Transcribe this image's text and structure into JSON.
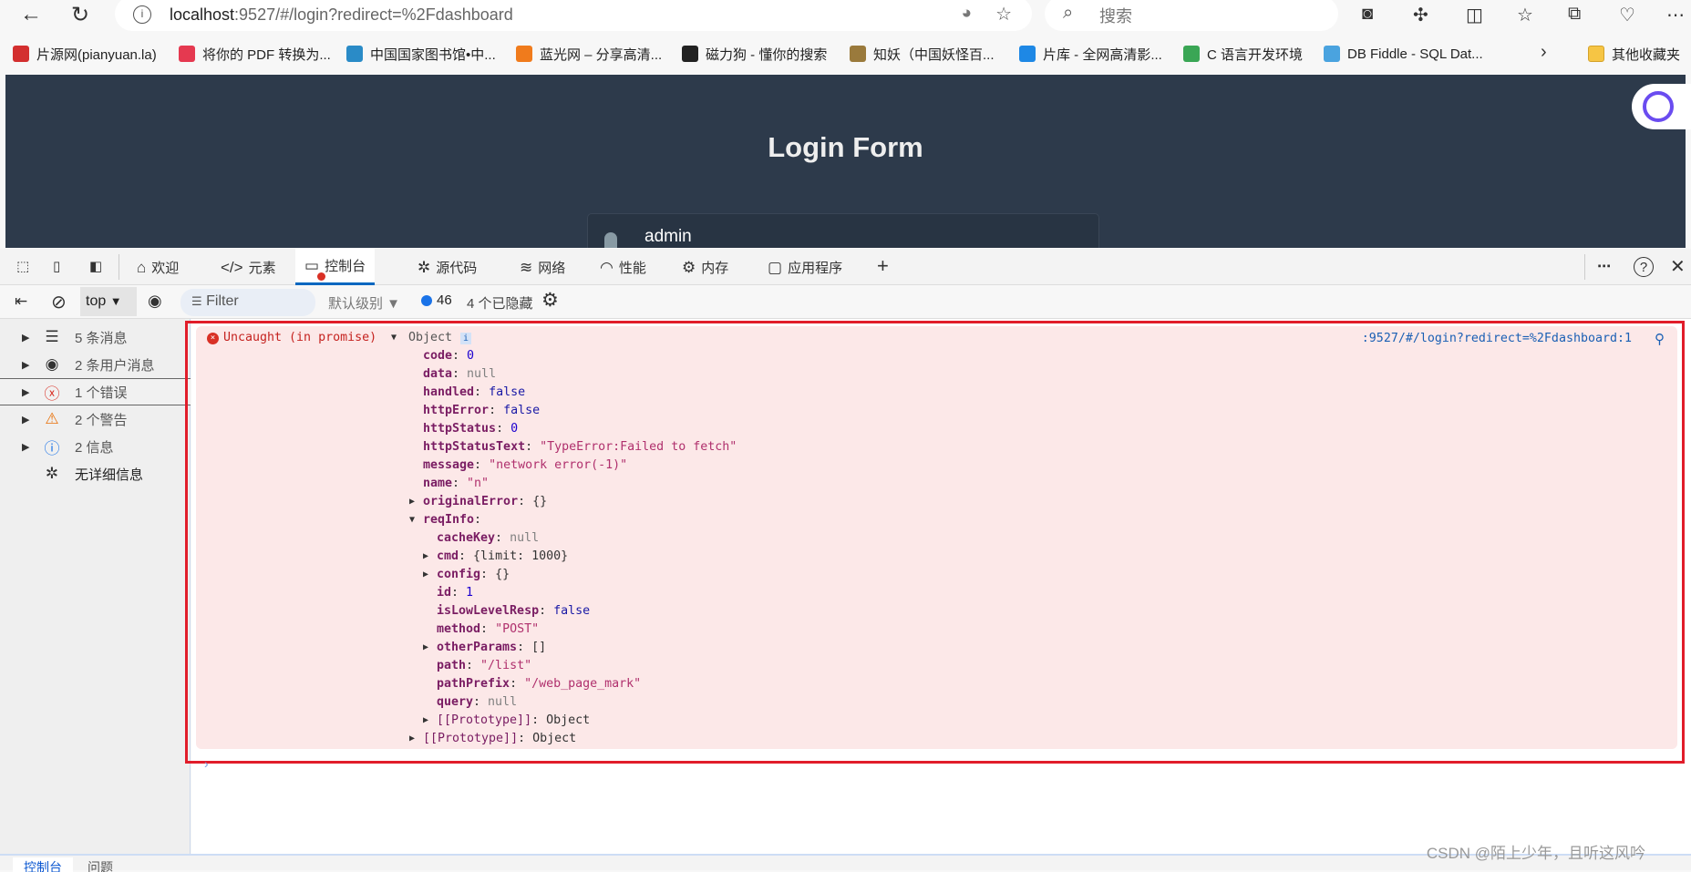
{
  "browser": {
    "url_host": "localhost",
    "url_rest": ":9527/#/login?redirect=%2Fdashboard",
    "search_placeholder": "搜索",
    "bookmarks": [
      {
        "label": "片源网(pianyuan.la)",
        "color": "#d32f2f"
      },
      {
        "label": "将你的 PDF 转换为...",
        "color": "#e53950"
      },
      {
        "label": "中国国家图书馆•中...",
        "color": "#2a8bc7"
      },
      {
        "label": "蓝光网 – 分享高清...",
        "color": "#f07b1c"
      },
      {
        "label": "磁力狗 - 懂你的搜索",
        "color": "#222222"
      },
      {
        "label": "知妖（中国妖怪百...",
        "color": "#9a7a3c"
      },
      {
        "label": "片库 - 全网高清影...",
        "color": "#1e88e5"
      },
      {
        "label": "C 语言开发环境",
        "color": "#3aa655"
      },
      {
        "label": "DB Fiddle - SQL Dat...",
        "color": "#4aa3df"
      }
    ],
    "other_bookmarks": "其他收藏夹"
  },
  "page": {
    "title": "Login Form",
    "username": "admin"
  },
  "devtools": {
    "tabs": [
      {
        "label": "欢迎",
        "icon": "home-icon"
      },
      {
        "label": "元素",
        "icon": "code-icon"
      },
      {
        "label": "控制台",
        "icon": "console-icon"
      },
      {
        "label": "源代码",
        "icon": "bug-icon"
      },
      {
        "label": "网络",
        "icon": "wifi-icon"
      },
      {
        "label": "性能",
        "icon": "gauge-icon"
      },
      {
        "label": "内存",
        "icon": "chip-icon"
      },
      {
        "label": "应用程序",
        "icon": "app-icon"
      }
    ],
    "active_tab": "控制台",
    "context": "top",
    "filter_placeholder": "Filter",
    "level": "默认级别",
    "message_count": "46",
    "hidden": "4 个已隐藏",
    "sidebar": [
      {
        "label": "5 条消息",
        "icon": "list-icon"
      },
      {
        "label": "2 条用户消息",
        "icon": "user-icon"
      },
      {
        "label": "1 个错误",
        "icon": "error-icon",
        "color": "#d93025"
      },
      {
        "label": "2 个警告",
        "icon": "warning-icon",
        "color": "#e8710a"
      },
      {
        "label": "2 信息",
        "icon": "info-icon",
        "color": "#1a73e8"
      },
      {
        "label": "无详细信息",
        "icon": "bug-icon"
      }
    ],
    "drawer_tabs": [
      "控制台",
      "问题"
    ]
  },
  "console": {
    "error_prefix": "Uncaught (in promise)",
    "object_label": "Object",
    "source": ":9527/#/login?redirect=%2Fdashboard:1",
    "props": [
      {
        "key": "code",
        "value": "0",
        "type": "num"
      },
      {
        "key": "data",
        "value": "null",
        "type": "nul"
      },
      {
        "key": "handled",
        "value": "false",
        "type": "bool"
      },
      {
        "key": "httpError",
        "value": "false",
        "type": "bool"
      },
      {
        "key": "httpStatus",
        "value": "0",
        "type": "num"
      },
      {
        "key": "httpStatusText",
        "value": "\"TypeError:Failed to fetch\"",
        "type": "str"
      },
      {
        "key": "message",
        "value": "\"network error(-1)\"",
        "type": "str"
      },
      {
        "key": "name",
        "value": "\"n\"",
        "type": "str"
      },
      {
        "key": "originalError",
        "value": "{}",
        "type": "obj",
        "expand": "collapsed"
      },
      {
        "key": "reqInfo",
        "value": "",
        "type": "obj",
        "expand": "expanded"
      }
    ],
    "reqInfo": [
      {
        "key": "cacheKey",
        "value": "null",
        "type": "nul"
      },
      {
        "key": "cmd",
        "value": "{limit: 1000}",
        "type": "obj",
        "expand": "collapsed"
      },
      {
        "key": "config",
        "value": "{}",
        "type": "obj",
        "expand": "collapsed"
      },
      {
        "key": "id",
        "value": "1",
        "type": "num"
      },
      {
        "key": "isLowLevelResp",
        "value": "false",
        "type": "bool"
      },
      {
        "key": "method",
        "value": "\"POST\"",
        "type": "str"
      },
      {
        "key": "otherParams",
        "value": "[]",
        "type": "obj",
        "expand": "collapsed"
      },
      {
        "key": "path",
        "value": "\"/list\"",
        "type": "str"
      },
      {
        "key": "pathPrefix",
        "value": "\"/web_page_mark\"",
        "type": "str"
      },
      {
        "key": "query",
        "value": "null",
        "type": "nul"
      },
      {
        "key": "[[Prototype]]",
        "value": "Object",
        "type": "proto",
        "expand": "collapsed"
      }
    ],
    "root_proto": {
      "key": "[[Prototype]]",
      "value": "Object"
    }
  },
  "watermark": "CSDN @陌上少年，且听这风吟"
}
